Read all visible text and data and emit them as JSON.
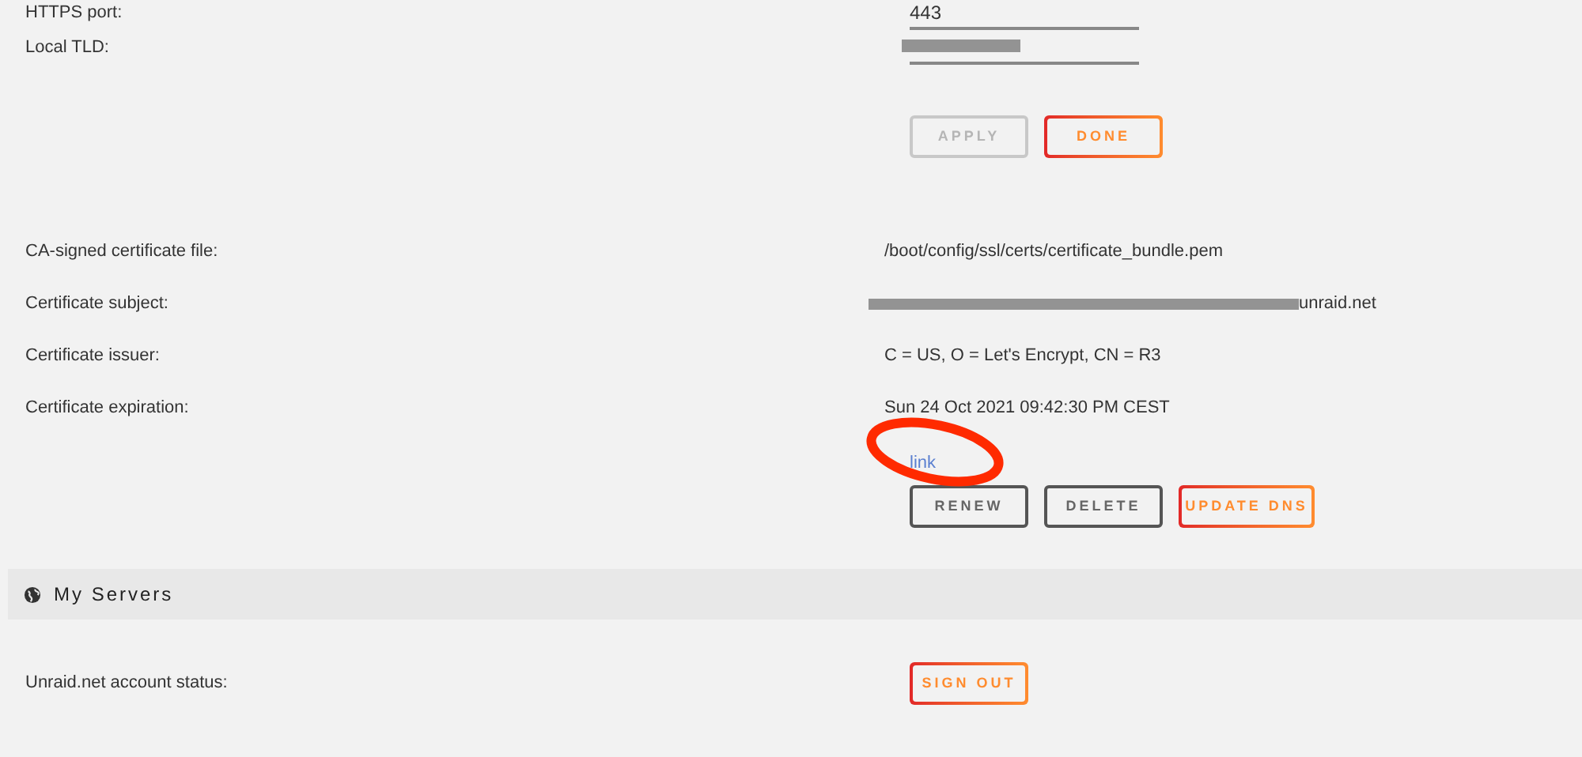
{
  "fields": [
    {
      "label": "HTTPS port:",
      "value": "443",
      "redacted": false
    },
    {
      "label": "Local TLD:",
      "redacted": true
    }
  ],
  "field_buttons": [
    {
      "label": "APPLY",
      "kind": "muted"
    },
    {
      "label": "DONE",
      "kind": "accent"
    }
  ],
  "certificate": [
    {
      "label": "CA-signed certificate file:",
      "value": "/boot/config/ssl/certs/certificate_bundle.pem",
      "redacted": false
    },
    {
      "label": "Certificate subject:",
      "value": "unraid.net",
      "redacted": true
    },
    {
      "label": "Certificate issuer:",
      "value": "C = US, O = Let's Encrypt, CN = R3",
      "redacted": false
    },
    {
      "label": "Certificate expiration:",
      "value": "Sun 24 Oct 2021 09:42:30 PM CEST",
      "redacted": false
    }
  ],
  "link": {
    "label": "link",
    "circled": true
  },
  "certificate_buttons": [
    {
      "label": "RENEW",
      "kind": "plain"
    },
    {
      "label": "DELETE",
      "kind": "plain"
    },
    {
      "label": "UPDATE DNS",
      "kind": "accent"
    }
  ],
  "section": {
    "title": "My Servers"
  },
  "account": {
    "label": "Unraid.net account status:",
    "button": {
      "label": "SIGN OUT",
      "kind": "accent"
    }
  }
}
